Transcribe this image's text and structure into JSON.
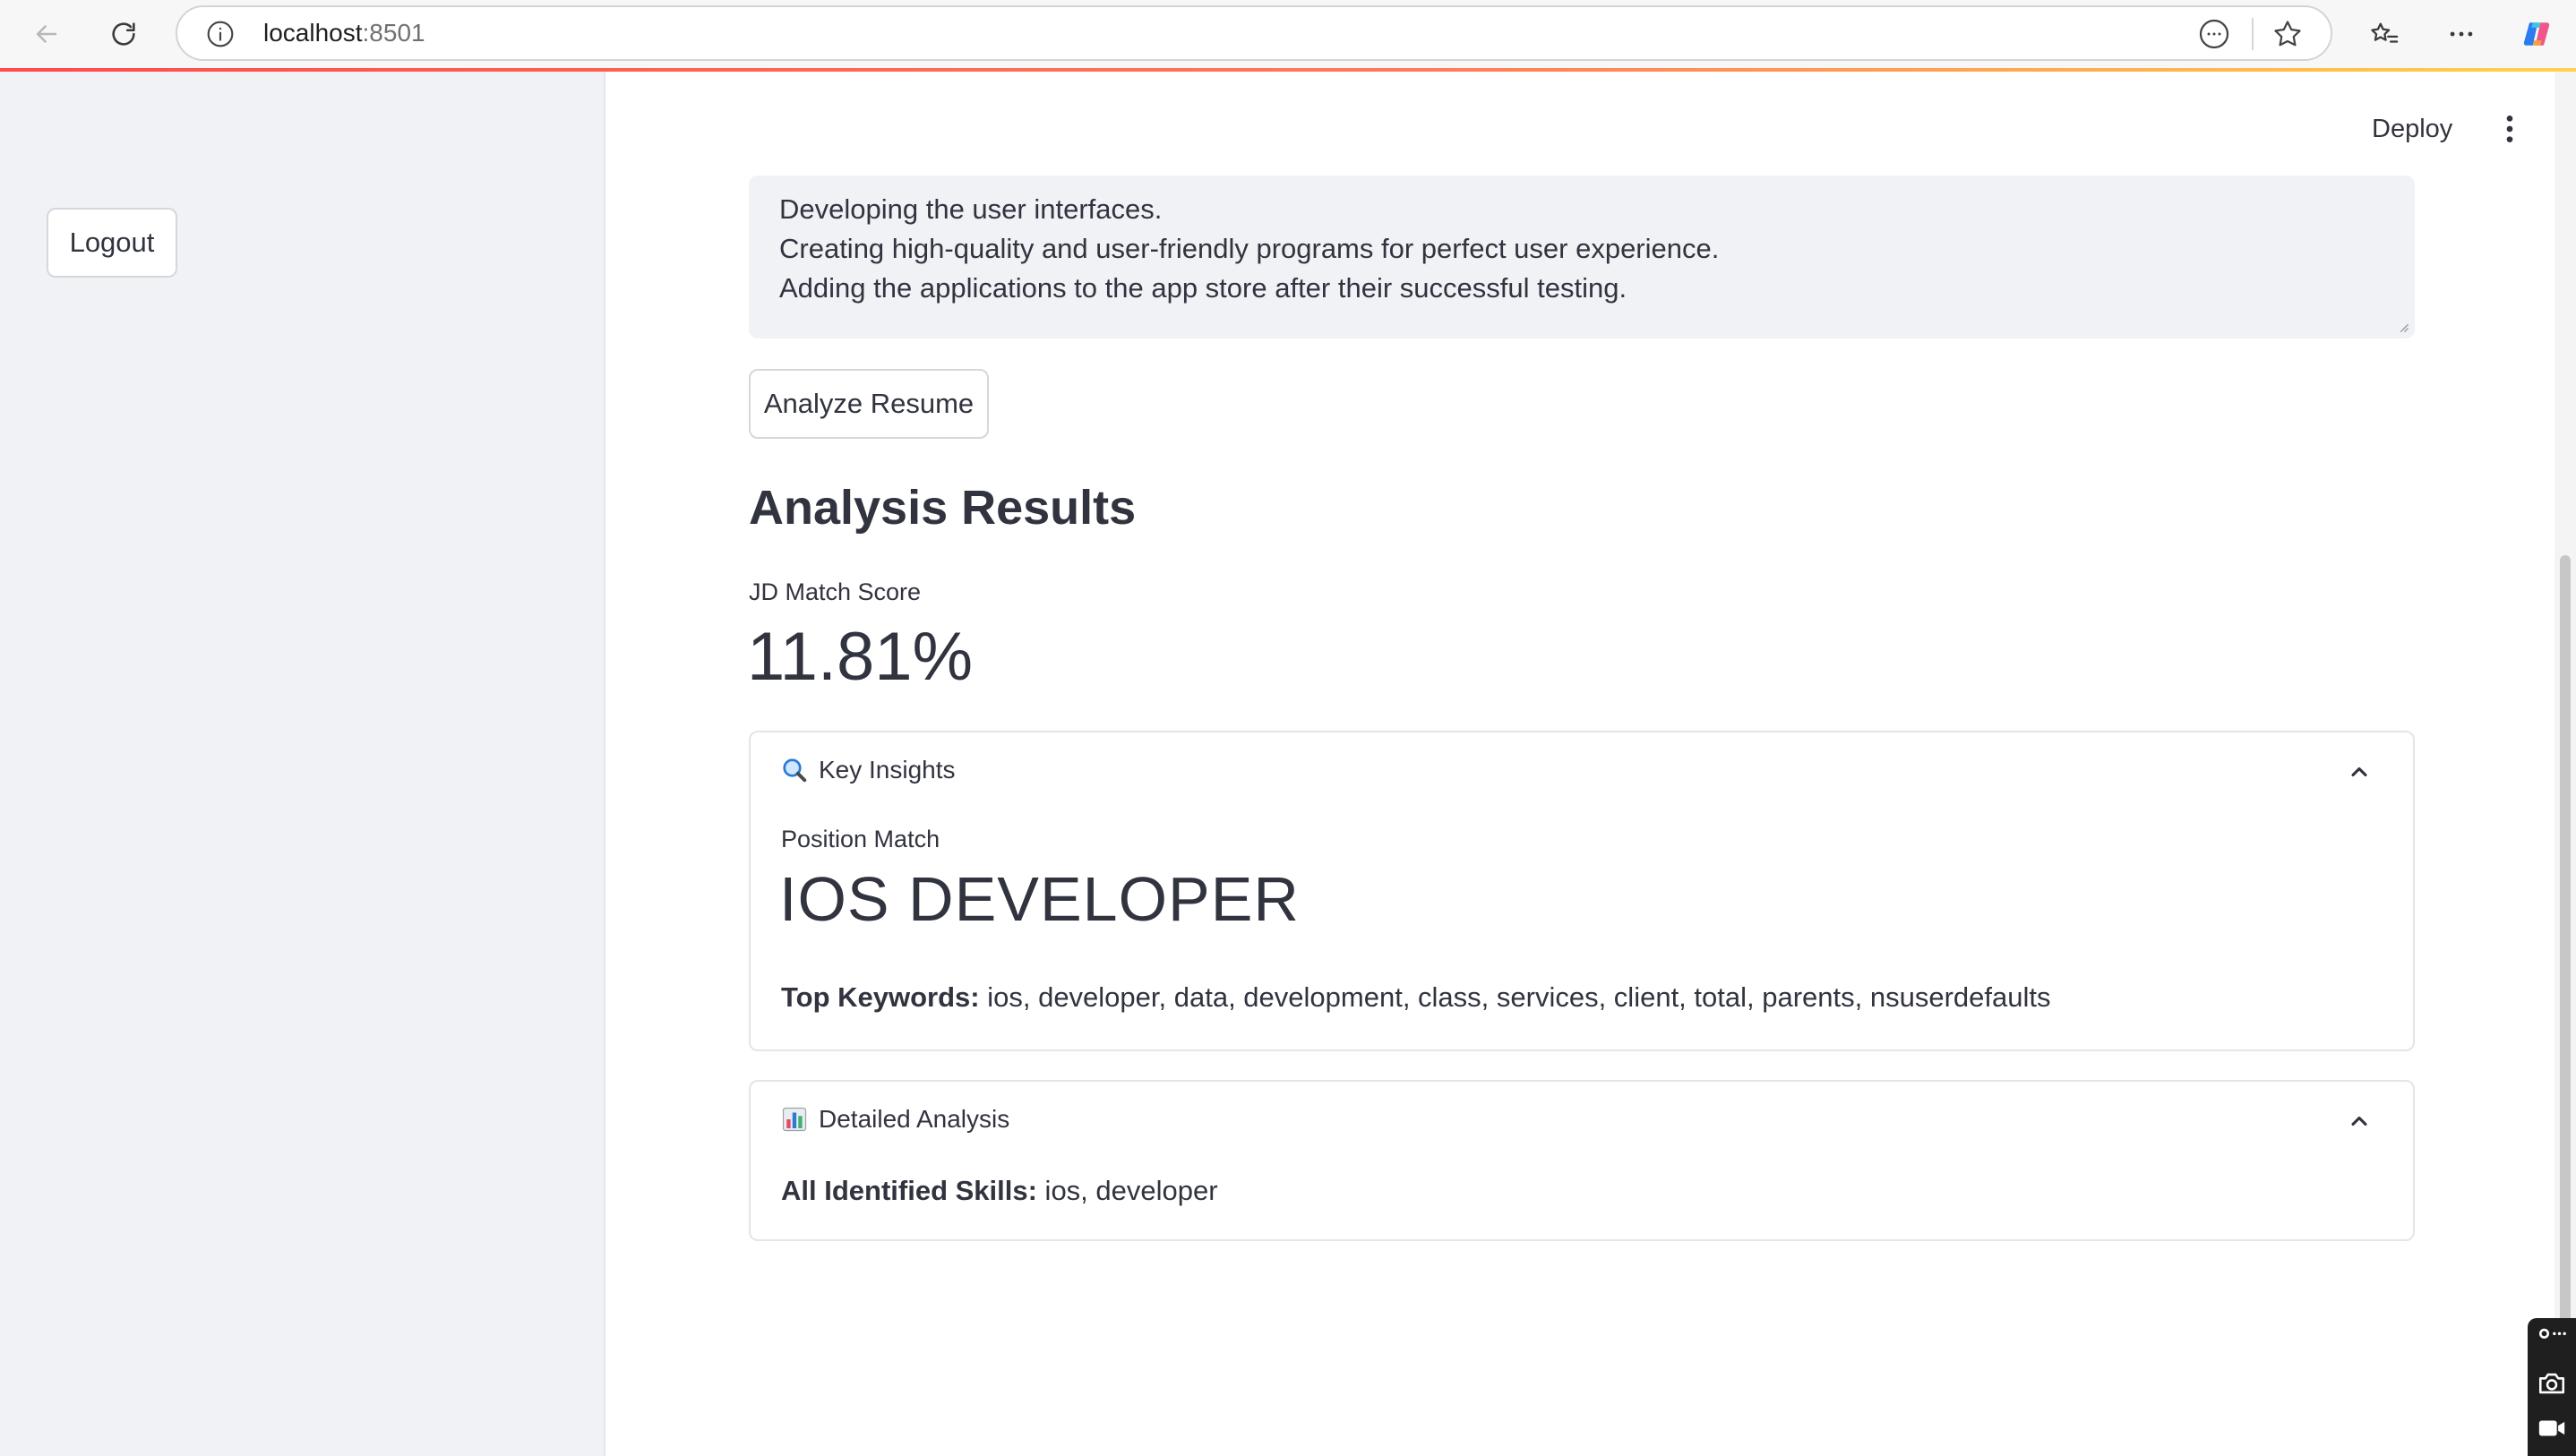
{
  "browser": {
    "url_host": "localhost",
    "url_port": ":8501"
  },
  "sidebar": {
    "logout_label": "Logout"
  },
  "header": {
    "deploy_label": "Deploy"
  },
  "job_description": {
    "lines": [
      "Developing the user interfaces.",
      "Creating high-quality and user-friendly programs for perfect user experience.",
      "Adding the applications to the app store after their successful testing."
    ]
  },
  "actions": {
    "analyze_label": "Analyze Resume"
  },
  "results": {
    "title": "Analysis Results",
    "metric_label": "JD Match Score",
    "metric_value": "11.81%"
  },
  "key_insights": {
    "title": "Key Insights",
    "icon": "magnifier-icon",
    "position_label": "Position Match",
    "position_value": "IOS DEVELOPER",
    "keywords_label": "Top Keywords:",
    "keywords_value": " ios, developer, data, development, class, services, client, total, parents, nsuserdefaults"
  },
  "detailed_analysis": {
    "title": "Detailed Analysis",
    "icon": "bar-chart-icon",
    "skills_label": "All Identified Skills:",
    "skills_value": " ios, developer"
  },
  "colors": {
    "accent_start": "#ff4b4b",
    "accent_end": "#ffd24b",
    "sidebar_bg": "#f0f2f6",
    "text": "#31333f"
  }
}
